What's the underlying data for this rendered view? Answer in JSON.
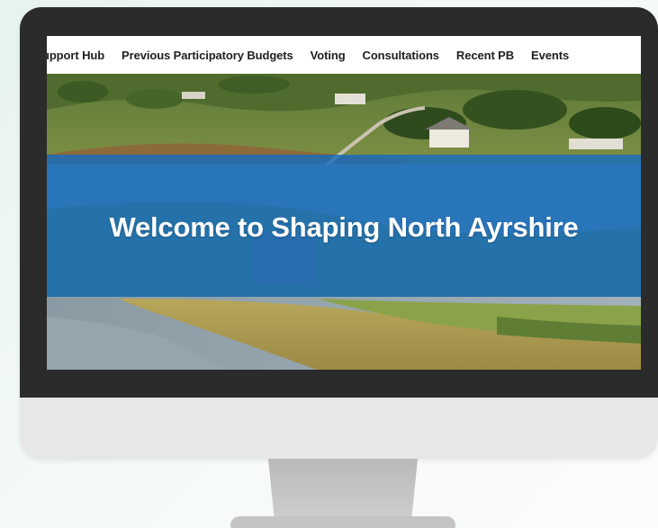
{
  "nav": {
    "items": [
      {
        "label": "upport Hub"
      },
      {
        "label": "Previous Participatory Budgets"
      },
      {
        "label": "Voting"
      },
      {
        "label": "Consultations"
      },
      {
        "label": "Recent PB"
      },
      {
        "label": "Events"
      }
    ]
  },
  "hero": {
    "title": "Welcome to Shaping North Ayrshire"
  },
  "colors": {
    "banner": "#166cbe",
    "bezel": "#2b2b2b",
    "monitor": "#e7e7e7"
  }
}
